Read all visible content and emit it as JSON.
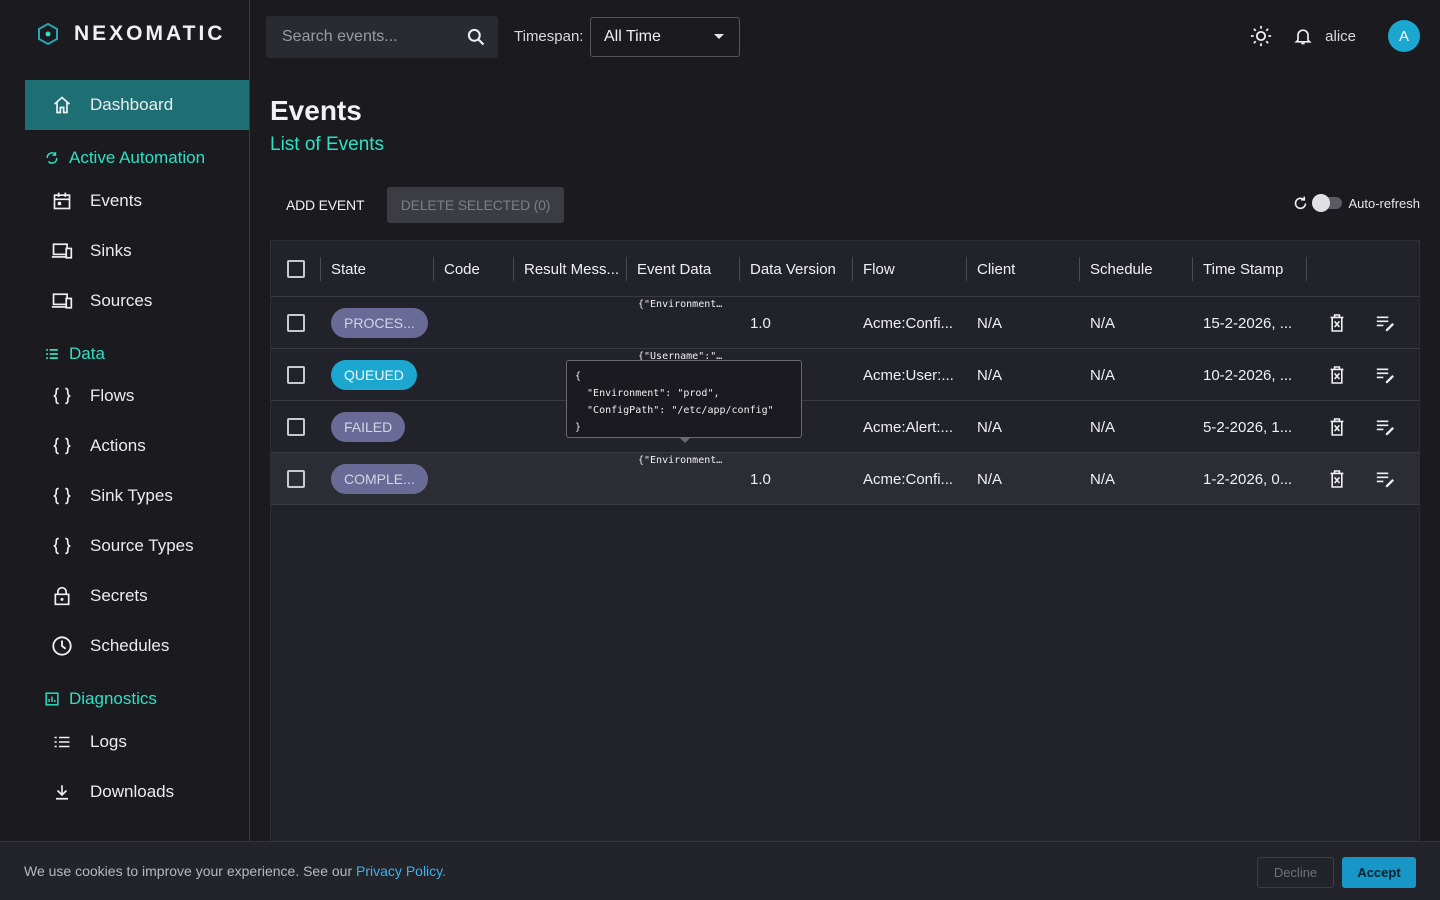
{
  "brand": {
    "name": "NEXOMATIC"
  },
  "sidebar": {
    "dashboard": "Dashboard",
    "sections": [
      {
        "title": "Active Automation",
        "items": [
          "Events",
          "Sinks",
          "Sources"
        ]
      },
      {
        "title": "Data",
        "items": [
          "Flows",
          "Actions",
          "Sink Types",
          "Source Types",
          "Secrets",
          "Schedules"
        ]
      },
      {
        "title": "Diagnostics",
        "items": [
          "Logs",
          "Downloads"
        ]
      }
    ]
  },
  "topbar": {
    "search_placeholder": "Search events...",
    "timespan_label": "Timespan:",
    "timespan_value": "All Time",
    "username": "alice",
    "avatar_initial": "A"
  },
  "page": {
    "title": "Events",
    "subtitle": "List of Events",
    "add_button": "ADD EVENT",
    "delete_button": "DELETE SELECTED (0)",
    "autorefresh_label": "Auto-refresh"
  },
  "table": {
    "columns": [
      "State",
      "Code",
      "Result Mess...",
      "Event Data",
      "Data Version",
      "Flow",
      "Client",
      "Schedule",
      "Time Stamp"
    ],
    "rows": [
      {
        "state": "PROCES...",
        "code": "",
        "result": "",
        "event_data": "{\"Environment…",
        "version": "1.0",
        "flow": "Acme:Confi...",
        "client": "N/A",
        "schedule": "N/A",
        "timestamp": "15-2-2026, ..."
      },
      {
        "state": "QUEUED",
        "code": "",
        "result": "",
        "event_data": "{\"Username\":\"…",
        "version": "",
        "flow": "Acme:User:...",
        "client": "N/A",
        "schedule": "N/A",
        "timestamp": "10-2-2026, ..."
      },
      {
        "state": "FAILED",
        "code": "",
        "result": "",
        "event_data": "",
        "version": "",
        "flow": "Acme:Alert:...",
        "client": "N/A",
        "schedule": "N/A",
        "timestamp": "5-2-2026, 1..."
      },
      {
        "state": "COMPLE...",
        "code": "",
        "result": "",
        "event_data": "{\"Environment…",
        "version": "1.0",
        "flow": "Acme:Confi...",
        "client": "N/A",
        "schedule": "N/A",
        "timestamp": "1-2-2026, 0..."
      }
    ],
    "tooltip": "{\n  \"Environment\": \"prod\",\n  \"ConfigPath\": \"/etc/app/config\"\n}"
  },
  "cookie": {
    "text": "We use cookies to improve your experience. See our ",
    "link": "Privacy Policy.",
    "decline": "Decline",
    "accept": "Accept"
  },
  "colors": {
    "accent": "#2ee0c4",
    "active_nav": "#1e6f73",
    "queued": "#1ba7cf",
    "badge": "#6a6a96",
    "bg": "#1a1a1f"
  }
}
